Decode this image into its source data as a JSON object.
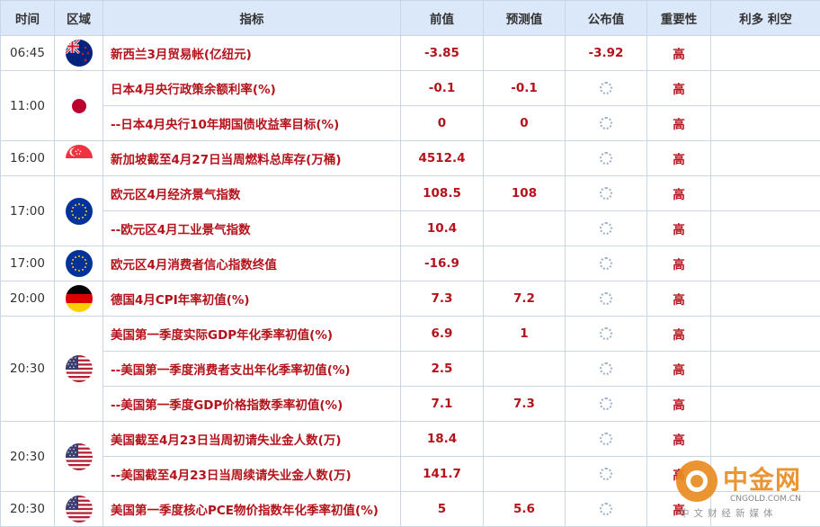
{
  "headers": {
    "time": "时间",
    "region": "区域",
    "indicator": "指标",
    "previous": "前值",
    "forecast": "预测值",
    "actual": "公布值",
    "importance": "重要性",
    "impact": "利多 利空"
  },
  "rows": [
    {
      "time": "06:45",
      "flag": "nz",
      "indicator": "新西兰3月贸易帐(亿纽元)",
      "previous": "-3.85",
      "forecast": "",
      "actual": "-3.92",
      "importance": "高"
    },
    {
      "time": "11:00",
      "flag": "jp",
      "indicator": "日本4月央行政策余额利率(%)",
      "previous": "-0.1",
      "forecast": "-0.1",
      "actual": "",
      "importance": "高"
    },
    {
      "time": "",
      "flag": "",
      "indicator": "--日本4月央行10年期国债收益率目标(%)",
      "previous": "0",
      "forecast": "0",
      "actual": "",
      "importance": "高"
    },
    {
      "time": "16:00",
      "flag": "sg",
      "indicator": "新加坡截至4月27日当周燃料总库存(万桶)",
      "previous": "4512.4",
      "forecast": "",
      "actual": "",
      "importance": "高"
    },
    {
      "time": "17:00",
      "flag": "eu",
      "indicator": "欧元区4月经济景气指数",
      "previous": "108.5",
      "forecast": "108",
      "actual": "",
      "importance": "高"
    },
    {
      "time": "",
      "flag": "",
      "indicator": "--欧元区4月工业景气指数",
      "previous": "10.4",
      "forecast": "",
      "actual": "",
      "importance": "高"
    },
    {
      "time": "17:00",
      "flag": "eu",
      "indicator": "欧元区4月消费者信心指数终值",
      "previous": "-16.9",
      "forecast": "",
      "actual": "",
      "importance": "高"
    },
    {
      "time": "20:00",
      "flag": "de",
      "indicator": "德国4月CPI年率初值(%)",
      "previous": "7.3",
      "forecast": "7.2",
      "actual": "",
      "importance": "高"
    },
    {
      "time": "20:30",
      "flag": "us",
      "indicator": "美国第一季度实际GDP年化季率初值(%)",
      "previous": "6.9",
      "forecast": "1",
      "actual": "",
      "importance": "高"
    },
    {
      "time": "",
      "flag": "",
      "indicator": "--美国第一季度消费者支出年化季率初值(%)",
      "previous": "2.5",
      "forecast": "",
      "actual": "",
      "importance": "高"
    },
    {
      "time": "",
      "flag": "",
      "indicator": "--美国第一季度GDP价格指数季率初值(%)",
      "previous": "7.1",
      "forecast": "7.3",
      "actual": "",
      "importance": "高"
    },
    {
      "time": "20:30",
      "flag": "us",
      "indicator": "美国截至4月23日当周初请失业金人数(万)",
      "previous": "18.4",
      "forecast": "",
      "actual": "",
      "importance": "高"
    },
    {
      "time": "",
      "flag": "",
      "indicator": "--美国截至4月23日当周续请失业金人数(万)",
      "previous": "141.7",
      "forecast": "",
      "actual": "",
      "importance": "高"
    },
    {
      "time": "20:30",
      "flag": "us",
      "indicator": "美国第一季度核心PCE物价指数年化季率初值(%)",
      "previous": "5",
      "forecast": "5.6",
      "actual": "",
      "importance": "高"
    }
  ],
  "watermark": {
    "name": "中金网",
    "site": "CNGOLD.COM.CN",
    "tagline": "中文财经新媒体"
  }
}
